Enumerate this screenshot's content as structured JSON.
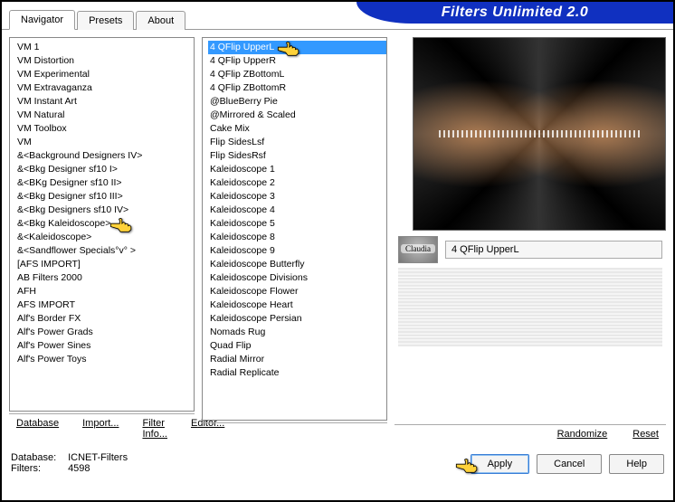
{
  "app_title": "Filters Unlimited 2.0",
  "tabs": [
    {
      "label": "Navigator",
      "active": true
    },
    {
      "label": "Presets",
      "active": false
    },
    {
      "label": "About",
      "active": false
    }
  ],
  "list1": {
    "items": [
      "VM 1",
      "VM Distortion",
      "VM Experimental",
      "VM Extravaganza",
      "VM Instant Art",
      "VM Natural",
      "VM Toolbox",
      "VM",
      "&<Background Designers IV>",
      "&<Bkg Designer sf10 I>",
      "&<BKg Designer sf10 II>",
      "&<Bkg Designer sf10 III>",
      "&<Bkg Designers sf10 IV>",
      "&<Bkg Kaleidoscope>",
      "&<Kaleidoscope>",
      "&<Sandflower Specials°v° >",
      "[AFS IMPORT]",
      "AB Filters 2000",
      "AFH",
      "AFS IMPORT",
      "Alf's Border FX",
      "Alf's Power Grads",
      "Alf's Power Sines",
      "Alf's Power Toys"
    ],
    "selected_index": null,
    "pointer_index": 13
  },
  "list2": {
    "items": [
      "4 QFlip UpperL",
      "4 QFlip UpperR",
      "4 QFlip ZBottomL",
      "4 QFlip ZBottomR",
      "@BlueBerry Pie",
      "@Mirrored & Scaled",
      "Cake Mix",
      "Flip SidesLsf",
      "Flip SidesRsf",
      "Kaleidoscope 1",
      "Kaleidoscope 2",
      "Kaleidoscope 3",
      "Kaleidoscope 4",
      "Kaleidoscope 5",
      "Kaleidoscope 8",
      "Kaleidoscope 9",
      "Kaleidoscope Butterfly",
      "Kaleidoscope Divisions",
      "Kaleidoscope Flower",
      "Kaleidoscope Heart",
      "Kaleidoscope Persian",
      "Nomads Rug",
      "Quad Flip",
      "Radial Mirror",
      "Radial Replicate"
    ],
    "selected_index": 0,
    "pointer_index": 0
  },
  "links_left": [
    {
      "label": "Database",
      "key": "D"
    },
    {
      "label": "Import...",
      "key": "I"
    },
    {
      "label": "Filter Info...",
      "key": "F"
    },
    {
      "label": "Editor...",
      "key": "E"
    }
  ],
  "links_right": [
    {
      "label": "Randomize"
    },
    {
      "label": "Reset"
    }
  ],
  "filter_label": "4 QFlip UpperL",
  "logo_text": "Claudia",
  "status": {
    "db_label": "Database:",
    "db_value": "ICNET-Filters",
    "filters_label": "Filters:",
    "filters_value": "4598"
  },
  "buttons": {
    "apply": "Apply",
    "cancel": "Cancel",
    "help": "Help"
  }
}
